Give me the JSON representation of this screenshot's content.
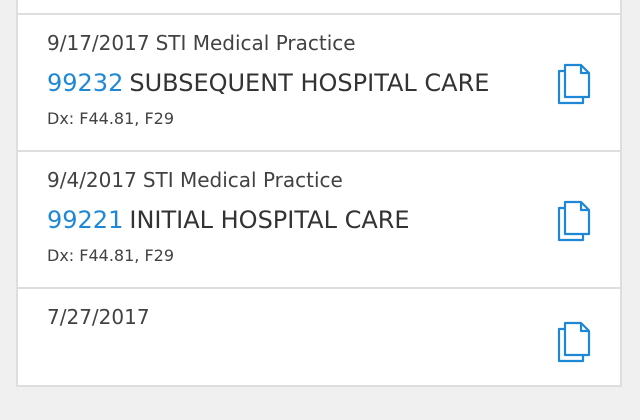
{
  "visits": [
    {
      "date": "9/17/2017",
      "practice": "STI Medical Practice",
      "code": "99232",
      "description": "SUBSEQUENT HOSPITAL CARE",
      "dx": "Dx: F44.81, F29"
    },
    {
      "date": "9/4/2017",
      "practice": "STI Medical Practice",
      "code": "99221",
      "description": "INITIAL HOSPITAL CARE",
      "dx": "Dx: F44.81, F29"
    },
    {
      "date": "7/27/2017"
    }
  ],
  "icons": {
    "document": "copy-document-icon"
  },
  "colors": {
    "accent": "#1e88d6",
    "text": "#333333",
    "divider": "#dedede",
    "background": "#f0f0f0"
  }
}
